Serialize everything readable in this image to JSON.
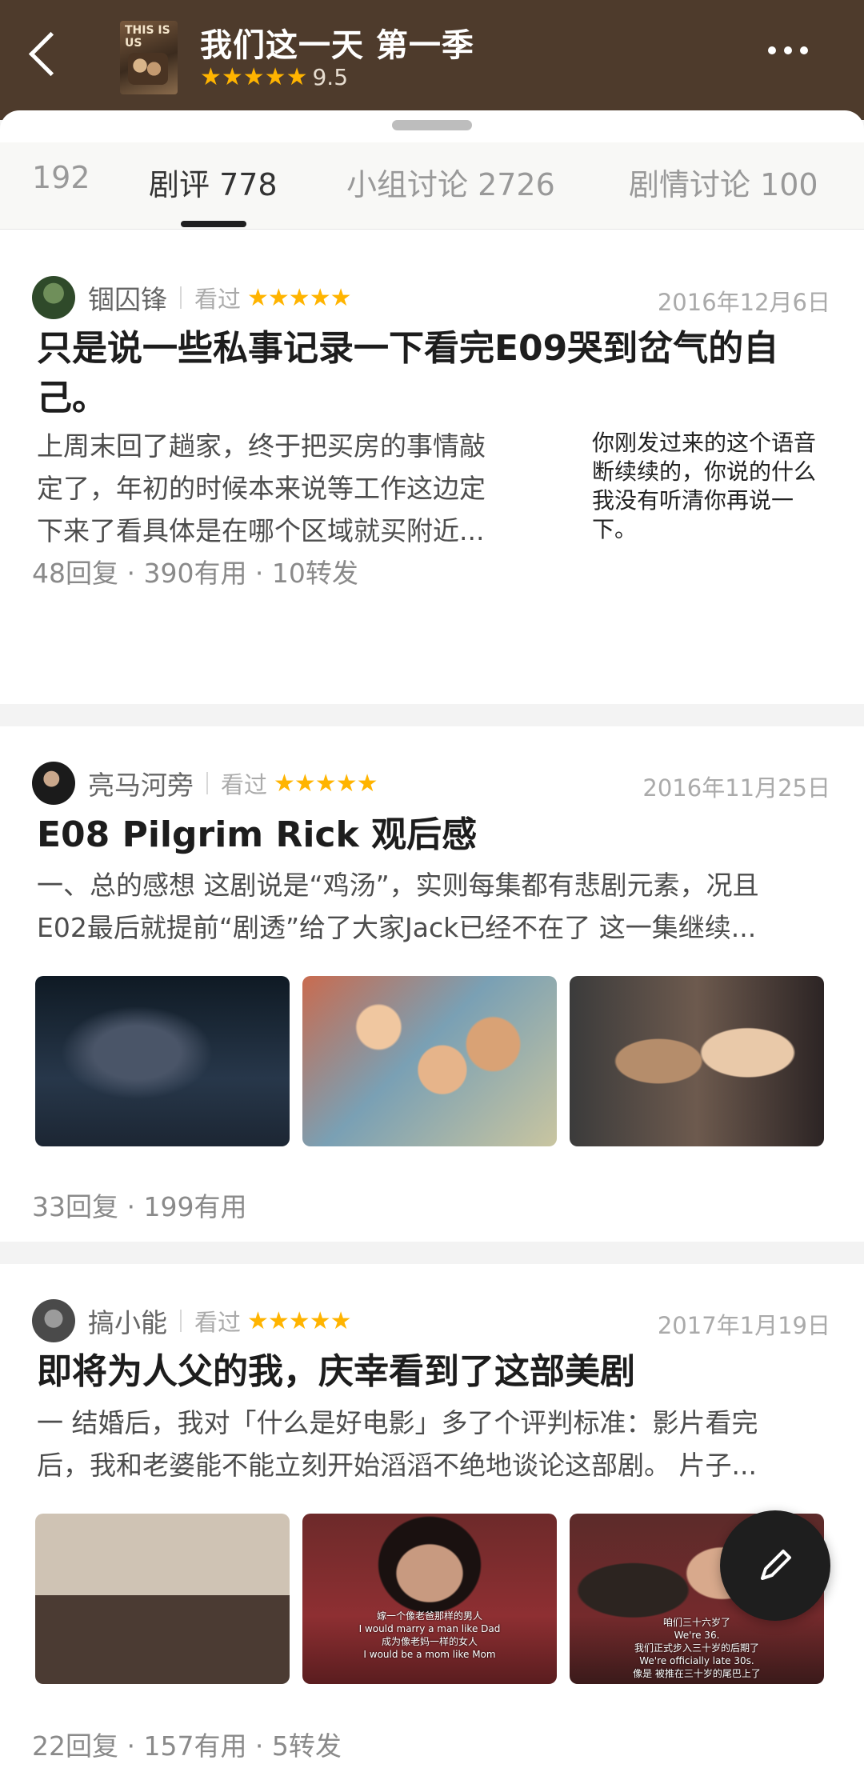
{
  "header": {
    "title": "我们这一天 第一季",
    "rating": "9.5",
    "stars": "★★★★★",
    "poster_text": "THIS IS US"
  },
  "tabs": [
    {
      "label": "192"
    },
    {
      "label": "剧评 778"
    },
    {
      "label": "小组讨论 2726"
    },
    {
      "label": "剧情讨论 100"
    }
  ],
  "reviews": [
    {
      "user": "锢囚锋",
      "status": "看过",
      "stars": "★★★★★",
      "date": "2016年12月6日",
      "title": "只是说一些私事记录一下看完E09哭到岔气的自己。",
      "excerpt_lines": [
        "上周末回了趟家，终于把买房的事情敲",
        "定了，年初的时候本来说等工作这边定",
        "下来了看具体是在哪个区域就买附近..."
      ],
      "thumb_lines": [
        "你刚发过来的这个语音",
        "断续续的，你说的什么",
        "我没有听清你再说一",
        "下。"
      ],
      "stats": "48回复 · 390有用 · 10转发"
    },
    {
      "user": "亮马河旁",
      "status": "看过",
      "stars": "★★★★★",
      "date": "2016年11月25日",
      "title": "E08  Pilgrim Rick 观后感",
      "excerpt_lines": [
        "一、总的感想 这剧说是“鸡汤”，实则每集都有悲剧元素，况且",
        "E02最后就提前“剧透”给了大家Jack已经不在了 这一集继续..."
      ],
      "stats": "33回复 · 199有用"
    },
    {
      "user": "搞小能",
      "status": "看过",
      "stars": "★★★★★",
      "date": "2017年1月19日",
      "title": "即将为人父的我，庆幸看到了这部美剧",
      "excerpt_lines": [
        "一 结婚后，我对「什么是好电影」多了个评判标准：影片看完",
        "后，我和老婆能不能立刻开始滔滔不绝地谈论这部剧。 片子..."
      ],
      "subs": {
        "img2": [
          "嫁一个像老爸那样的男人",
          "I would marry a man like Dad",
          "成为像老妈一样的女人",
          "I would be a mom like Mom"
        ],
        "img3": [
          "咱们三十六岁了",
          "We're 36.",
          "我们正式步入三十岁的后期了",
          "We're officially late 30s.",
          "像是 被推在三十岁的尾巴上了"
        ]
      },
      "stats": "22回复 · 157有用 · 5转发"
    }
  ],
  "icons": {
    "back": "back-arrow-icon",
    "more": "more-dots-icon",
    "fab": "pencil-icon"
  },
  "colors": {
    "header_bg": "#4e3b2c",
    "star": "#ffb400",
    "fab_bg": "#1e1e1e"
  }
}
